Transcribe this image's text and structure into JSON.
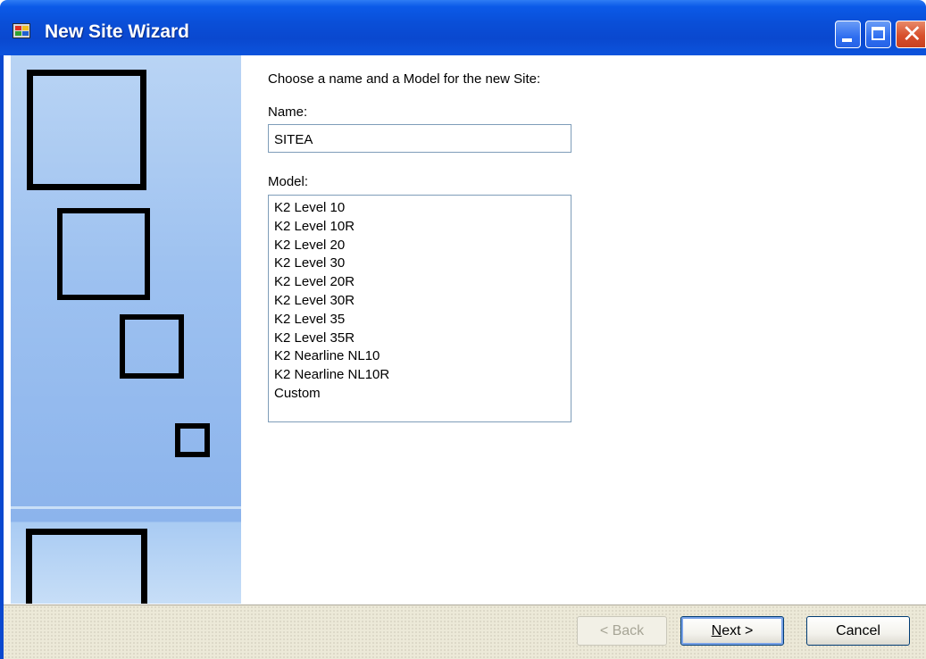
{
  "window": {
    "title": "New Site Wizard",
    "controls": {
      "minimize": "minimize",
      "maximize": "maximize",
      "close": "close"
    }
  },
  "form": {
    "prompt": "Choose a name and a Model for the new Site:",
    "name_label": "Name:",
    "name_value": "SITEA",
    "model_label": "Model:",
    "model_options": [
      "K2 Level 10",
      "K2 Level 10R",
      "K2 Level 20",
      "K2 Level 30",
      "K2 Level 20R",
      "K2 Level 30R",
      "K2 Level 35",
      "K2 Level 35R",
      "K2 Nearline NL10",
      "K2 Nearline NL10R",
      "Custom"
    ]
  },
  "buttons": {
    "back": "< Back",
    "next_mnemonic": "N",
    "next_rest": "ext >",
    "cancel": "Cancel"
  },
  "colors": {
    "titlebar": "#0a4fd8",
    "side_panel": "#9dc1f0",
    "footer": "#ece9d8",
    "input_border": "#7f9db9"
  },
  "icons": [
    "app-icon",
    "minimize-icon",
    "maximize-icon",
    "close-icon"
  ]
}
